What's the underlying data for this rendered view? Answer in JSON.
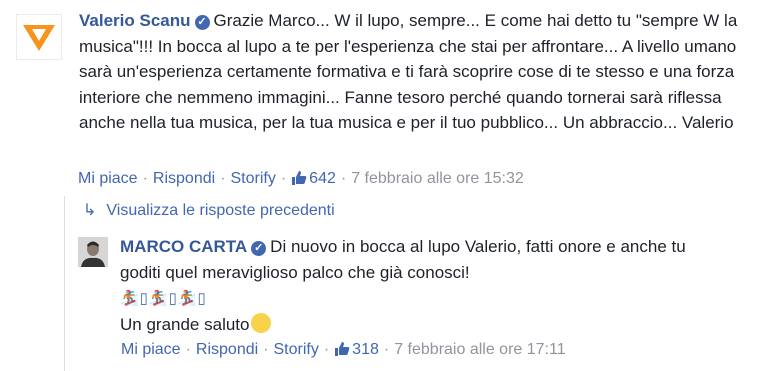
{
  "comment1": {
    "author": "Valerio Scanu",
    "text": "Grazie Marco... W il lupo, sempre... E come hai detto tu \"sempre W la musica\"!!! In bocca al lupo a te per l'esperienza che stai per affrontare... A livello umano sarà un'esperienza certamente formativa e ti farà scoprire cose di te stesso e una forza interiore che nemmeno immagini... Fanne tesoro perché quando tornerai sarà riflessa anche nella tua musica, per la tua musica e per il tuo pubblico... Un abbraccio... Valerio",
    "actions": {
      "like": "Mi piace",
      "reply": "Rispondi",
      "storify": "Storify",
      "like_count": "642",
      "timestamp": "7 febbraio alle ore 15:32"
    }
  },
  "replies": {
    "view_previous": "Visualizza le risposte precedenti"
  },
  "comment2": {
    "author": "MARCO CARTA",
    "text": "Di nuovo in bocca al lupo Valerio, fatti onore e anche tu goditi quel meraviglioso palco che già conosci!",
    "emoji_line": "🏂▯🏂▯🏂▯",
    "closing": "Un grande saluto",
    "actions": {
      "like": "Mi piace",
      "reply": "Rispondi",
      "storify": "Storify",
      "like_count": "318",
      "timestamp": "7 febbraio alle ore 17:11"
    }
  },
  "colors": {
    "link": "#4267b2",
    "author": "#365899",
    "meta": "#90949c",
    "logo_orange": "#f7941d"
  }
}
